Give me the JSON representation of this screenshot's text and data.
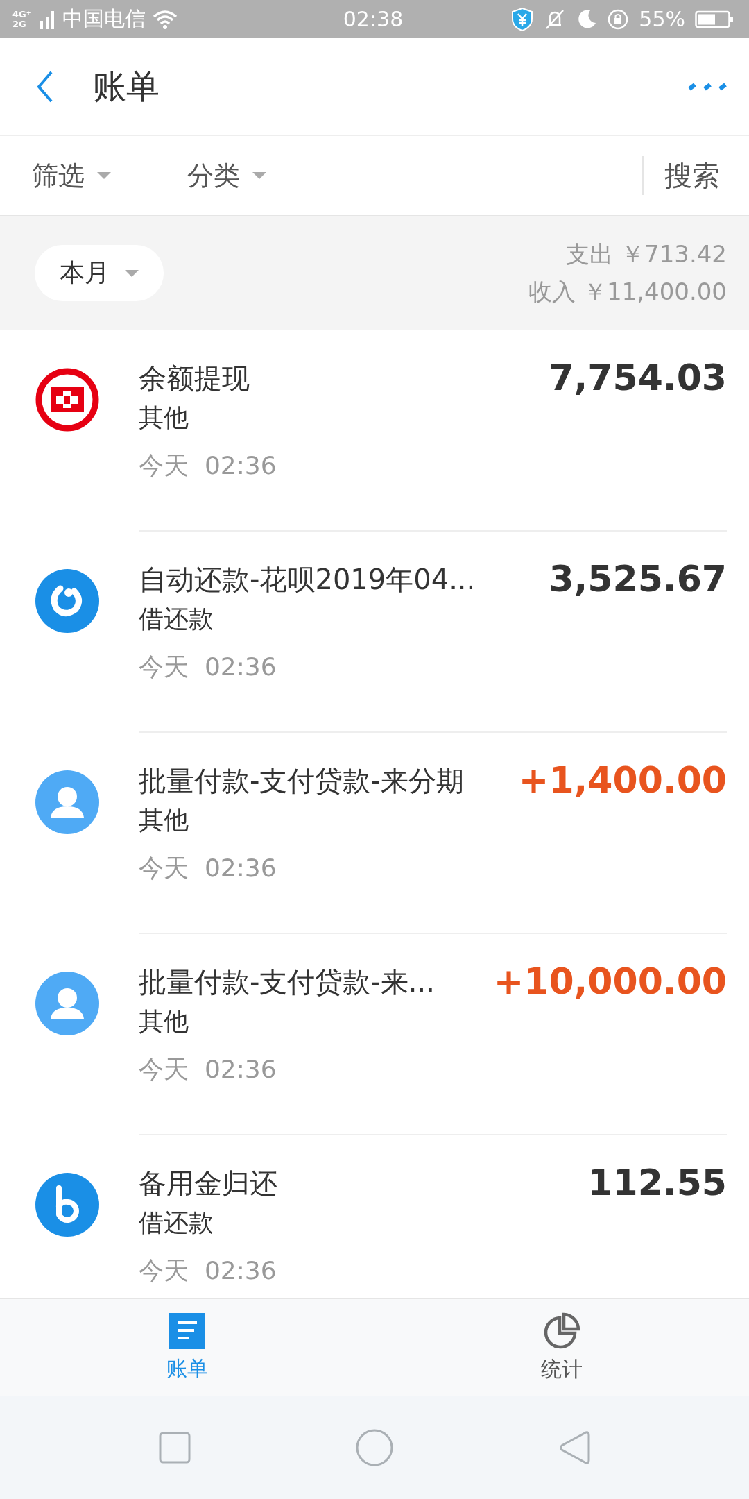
{
  "status_bar": {
    "network": "4G⁺ 2G",
    "carrier": "中国电信",
    "time": "02:38",
    "battery": "55%"
  },
  "header": {
    "title": "账单"
  },
  "filters": [
    {
      "label": "筛选"
    },
    {
      "label": "分类"
    }
  ],
  "search": {
    "label": "搜索"
  },
  "summary": {
    "period": "本月",
    "expense": "支出 ￥713.42",
    "income": "收入 ￥11,400.00"
  },
  "transactions": [
    {
      "kind": "bank",
      "title": "余额提现",
      "category": "其他",
      "time": "今天  02:36",
      "amount": "7,754.03",
      "income": false
    },
    {
      "kind": "huabei",
      "title": "自动还款-花呗2019年04...",
      "category": "借还款",
      "time": "今天  02:36",
      "amount": "3,525.67",
      "income": false
    },
    {
      "kind": "person",
      "title": "批量付款-支付贷款-来分期",
      "category": "其他",
      "time": "今天  02:36",
      "amount": "+1,400.00",
      "income": true
    },
    {
      "kind": "person",
      "title": "批量付款-支付贷款-来...",
      "category": "其他",
      "time": "今天  02:36",
      "amount": "+10,000.00",
      "income": true
    },
    {
      "kind": "beiyongjin",
      "title": "备用金归还",
      "category": "借还款",
      "time": "今天  02:36",
      "amount": "112.55",
      "income": false
    }
  ],
  "tabs": [
    {
      "label": "账单",
      "kind": "bill",
      "selected": true
    },
    {
      "label": "统计",
      "kind": "stats",
      "selected": false
    }
  ]
}
